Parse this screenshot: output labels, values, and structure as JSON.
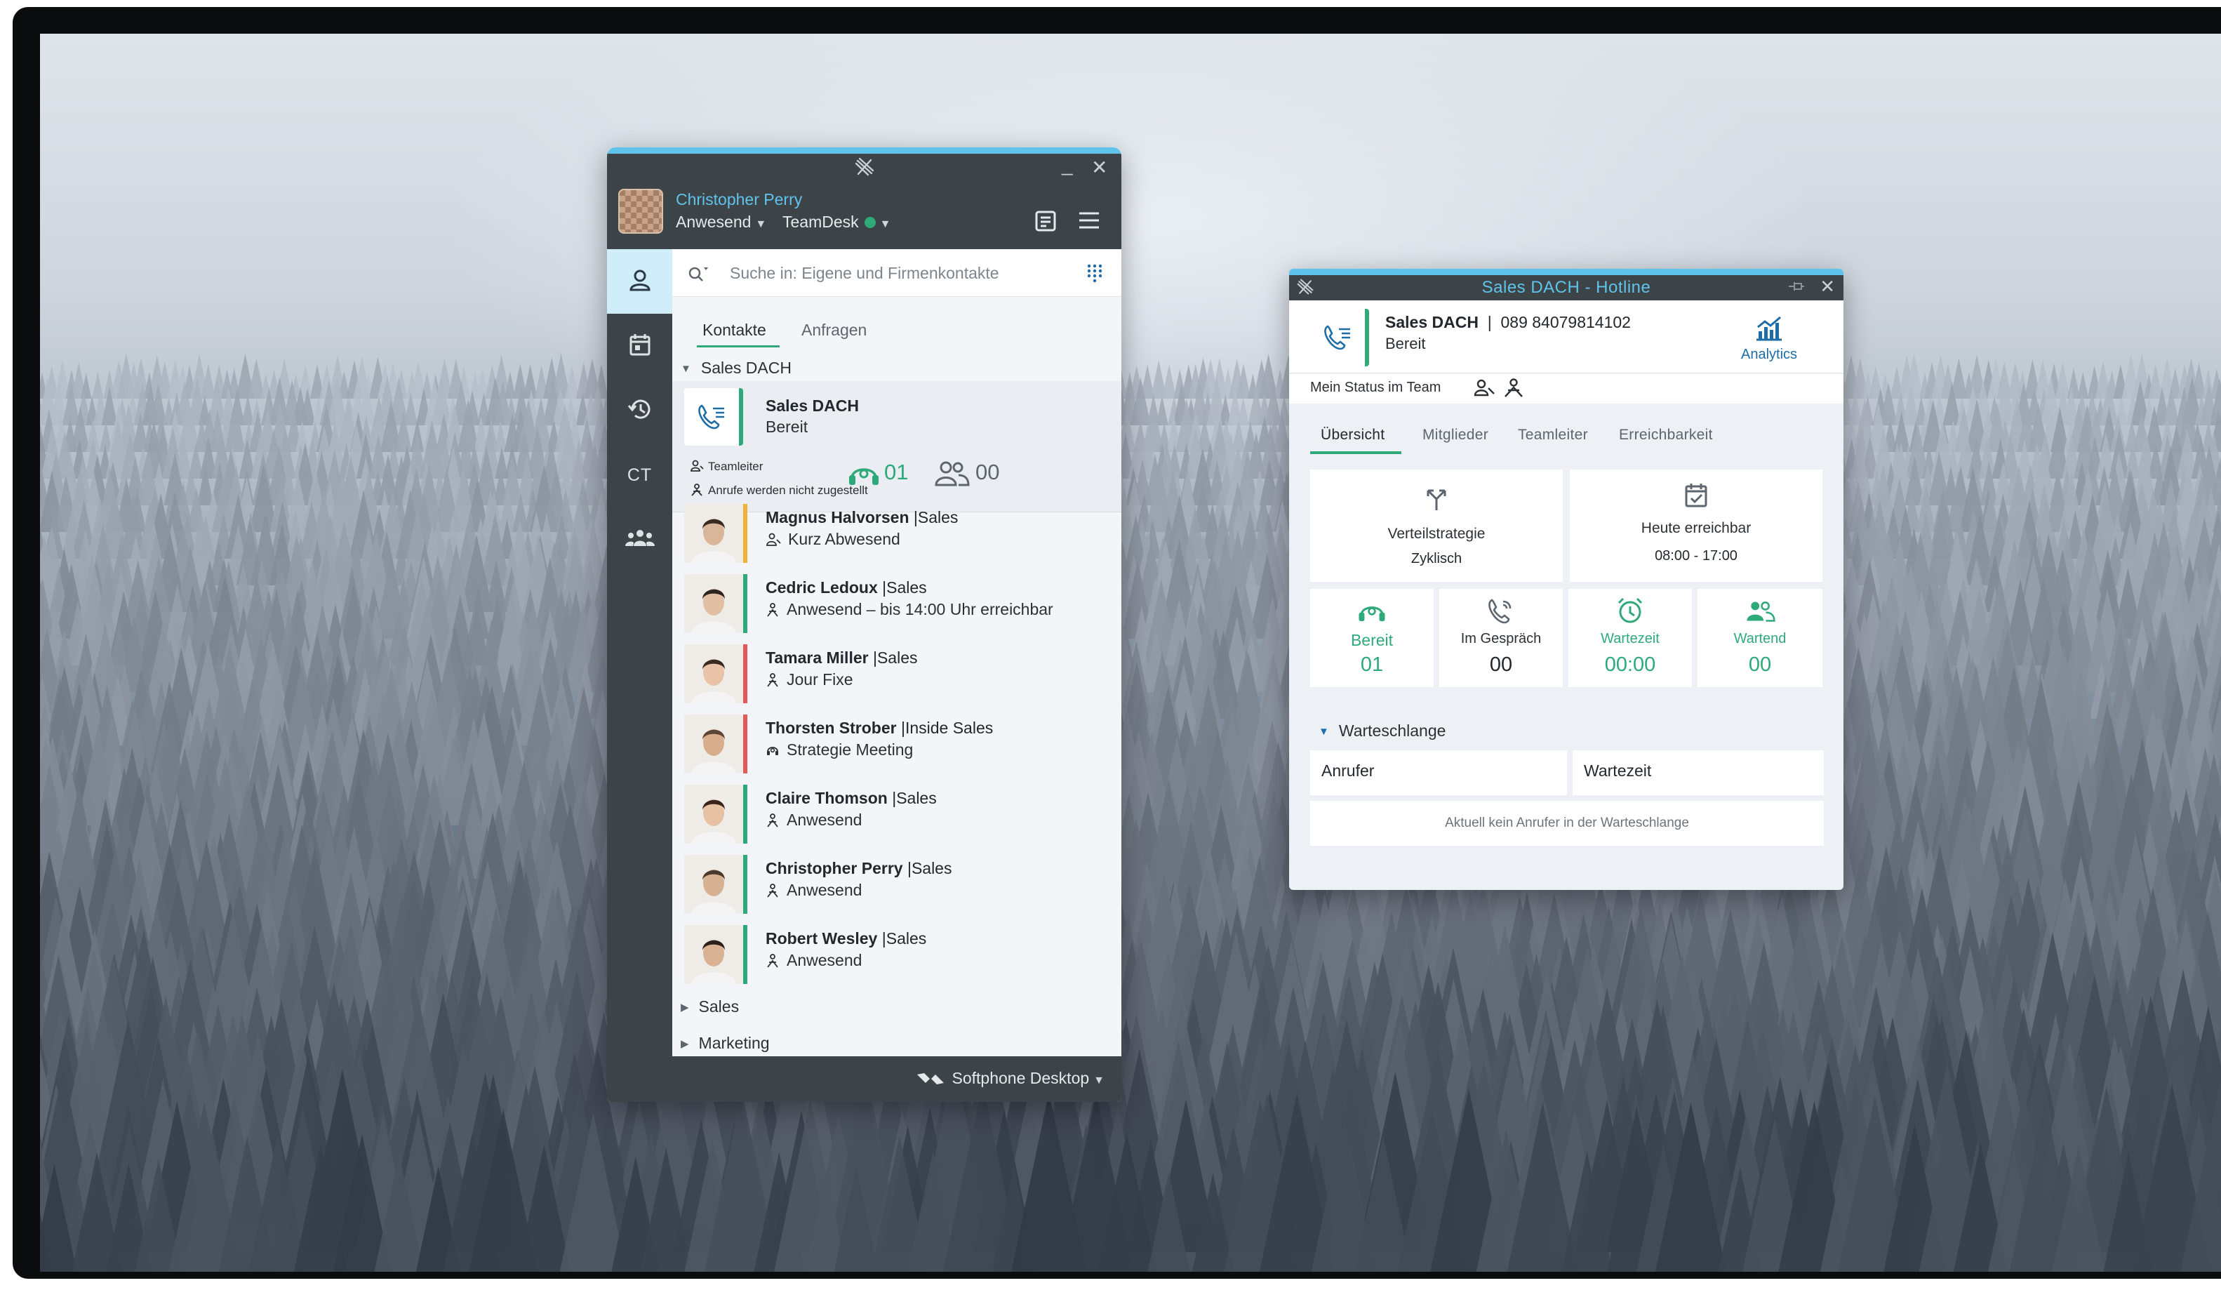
{
  "main": {
    "user": {
      "name": "Christopher Perry",
      "status": "Anwesend",
      "team": "TeamDesk"
    },
    "search": {
      "placeholder": "Suche in: Eigene und Firmenkontakte"
    },
    "rail": {
      "ct_label": "CT"
    },
    "tabs": [
      "Kontakte",
      "Anfragen"
    ],
    "group": {
      "name": "Sales DACH",
      "card": {
        "title": "Sales DACH",
        "status": "Bereit",
        "role": "Teamleiter",
        "note": "Anrufe werden nicht zugestellt",
        "ready_count": "01",
        "waiting_count": "00"
      }
    },
    "contacts": [
      {
        "name": "Magnus Halvorsen",
        "dept": "Sales",
        "status": "Kurz Abwesend",
        "color": "#f2b134",
        "icon": "away-icon"
      },
      {
        "name": "Cedric Ledoux",
        "dept": "Sales",
        "status": "Anwesend – bis 14:00 Uhr erreichbar",
        "color": "#2eaa7a",
        "icon": "present-icon"
      },
      {
        "name": "Tamara Miller",
        "dept": "Sales",
        "status": "Jour Fixe",
        "color": "#e05a5a",
        "icon": "present-icon"
      },
      {
        "name": "Thorsten Strober",
        "dept": "Inside Sales",
        "status": "Strategie Meeting",
        "color": "#e05a5a",
        "icon": "headset-icon"
      },
      {
        "name": "Claire Thomson",
        "dept": "Sales",
        "status": "Anwesend",
        "color": "#2eaa7a",
        "icon": "present-icon"
      },
      {
        "name": "Christopher Perry",
        "dept": "Sales",
        "status": "Anwesend",
        "color": "#2eaa7a",
        "icon": "present-icon"
      },
      {
        "name": "Robert Wesley",
        "dept": "Sales",
        "status": "Anwesend",
        "color": "#2eaa7a",
        "icon": "present-icon"
      }
    ],
    "collapsed_groups": [
      "Sales",
      "Marketing"
    ],
    "footer": {
      "device": "Softphone Desktop"
    }
  },
  "hotline": {
    "title": "Sales DACH - Hotline",
    "name": "Sales DACH",
    "separator": "|",
    "number": "089 84079814102",
    "status": "Bereit",
    "analytics_label": "Analytics",
    "my_status_label": "Mein Status im Team",
    "tabs": [
      "Übersicht",
      "Mitglieder",
      "Teamleiter",
      "Erreichbarkeit"
    ],
    "strategy": {
      "label": "Verteilstrategie",
      "value": "Zyklisch"
    },
    "reachable": {
      "label": "Heute erreichbar",
      "value": "08:00 - 17:00"
    },
    "stats": [
      {
        "label": "Bereit",
        "value": "01"
      },
      {
        "label": "Im Gespräch",
        "value": "00"
      },
      {
        "label": "Wartezeit",
        "value": "00:00"
      },
      {
        "label": "Wartend",
        "value": "00"
      }
    ],
    "queue": {
      "title": "Warteschlange",
      "columns": [
        "Anrufer",
        "Wartezeit"
      ],
      "empty_text": "Aktuell kein Anrufer in der Warteschlange"
    }
  },
  "colors": {
    "accent": "#2eaa7a",
    "brand": "#5fc3ec",
    "chrome": "#3d4448",
    "link": "#1d6da8"
  }
}
